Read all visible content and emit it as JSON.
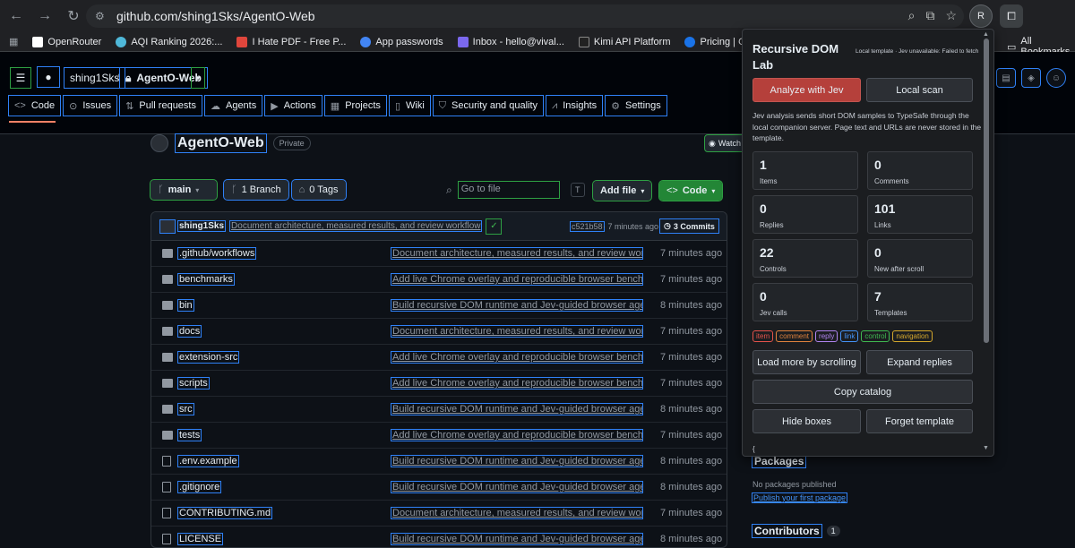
{
  "browser": {
    "url": "github.com/shing1Sks/AgentO-Web",
    "profile_initial": "R",
    "bookmarks": [
      {
        "label": "OpenRouter",
        "color": "#ffffff"
      },
      {
        "label": "AQI Ranking 2026:...",
        "color": "#4fb8d9"
      },
      {
        "label": "I Hate PDF - Free P...",
        "color": "#e0463c"
      },
      {
        "label": "App passwords",
        "color": "#4285f4"
      },
      {
        "label": "Inbox - hello@vival...",
        "color": "#7b68ee"
      },
      {
        "label": "Kimi API Platform",
        "color": "#222222"
      },
      {
        "label": "Pricing | OpenAI API",
        "color": "#1a73e8"
      }
    ],
    "all_bookmarks": "All Bookmarks"
  },
  "repo": {
    "owner": "shing1Sks",
    "name": "AgentO-Web",
    "visibility": "Private",
    "tabs": [
      "Code",
      "Issues",
      "Pull requests",
      "Agents",
      "Actions",
      "Projects",
      "Wiki",
      "Security and quality",
      "Insights",
      "Settings"
    ],
    "watch_label": "Watch",
    "branch": "main",
    "branch_count": "1 Branch",
    "tag_count": "0 Tags",
    "search_placeholder": "Go to file",
    "search_key": "T",
    "add_file": "Add file",
    "code_btn": "Code"
  },
  "latest_commit": {
    "author": "shing1Sks",
    "message": "Document architecture, measured results, and review workflow",
    "sha": "c521b58",
    "time": "· 7 minutes ago",
    "commits": "3 Commits"
  },
  "files": [
    {
      "name": ".github/workflows",
      "type": "dir",
      "msg": "Document architecture, measured results, and review workflow",
      "time": "7 minutes ago"
    },
    {
      "name": "benchmarks",
      "type": "dir",
      "msg": "Add live Chrome overlay and reproducible browser benchma...",
      "time": "7 minutes ago"
    },
    {
      "name": "bin",
      "type": "dir",
      "msg": "Build recursive DOM runtime and Jev-guided browser agent",
      "time": "8 minutes ago"
    },
    {
      "name": "docs",
      "type": "dir",
      "msg": "Document architecture, measured results, and review workflow",
      "time": "7 minutes ago"
    },
    {
      "name": "extension-src",
      "type": "dir",
      "msg": "Add live Chrome overlay and reproducible browser benchma...",
      "time": "7 minutes ago"
    },
    {
      "name": "scripts",
      "type": "dir",
      "msg": "Add live Chrome overlay and reproducible browser benchma...",
      "time": "7 minutes ago"
    },
    {
      "name": "src",
      "type": "dir",
      "msg": "Build recursive DOM runtime and Jev-guided browser agent",
      "time": "8 minutes ago"
    },
    {
      "name": "tests",
      "type": "dir",
      "msg": "Add live Chrome overlay and reproducible browser benchma...",
      "time": "7 minutes ago"
    },
    {
      "name": ".env.example",
      "type": "file",
      "msg": "Build recursive DOM runtime and Jev-guided browser agent",
      "time": "8 minutes ago"
    },
    {
      "name": ".gitignore",
      "type": "file",
      "msg": "Build recursive DOM runtime and Jev-guided browser agent",
      "time": "8 minutes ago"
    },
    {
      "name": "CONTRIBUTING.md",
      "type": "file",
      "msg": "Document architecture, measured results, and review workflow",
      "time": "7 minutes ago"
    },
    {
      "name": "LICENSE",
      "type": "file",
      "msg": "Build recursive DOM runtime and Jev-guided browser agent",
      "time": "8 minutes ago"
    }
  ],
  "sidebar": {
    "packages_title": "Packages",
    "packages_text": "No packages published",
    "packages_link": "Publish your first package",
    "contributors_title": "Contributors",
    "contributors_count": "1"
  },
  "panel": {
    "title": "Recursive DOM Lab",
    "status": "Local template · Jev unavailable: Failed to fetch",
    "analyze_btn": "Analyze with Jev",
    "scan_btn": "Local scan",
    "description": "Jev analysis sends short DOM samples to TypeSafe through the local companion server. Page text and URLs are never stored in the template.",
    "stats": [
      {
        "value": "1",
        "label": "Items"
      },
      {
        "value": "0",
        "label": "Comments"
      },
      {
        "value": "0",
        "label": "Replies"
      },
      {
        "value": "101",
        "label": "Links"
      },
      {
        "value": "22",
        "label": "Controls"
      },
      {
        "value": "0",
        "label": "New after scroll"
      },
      {
        "value": "0",
        "label": "Jev calls"
      },
      {
        "value": "7",
        "label": "Templates"
      }
    ],
    "legend": [
      {
        "label": "item",
        "color": "#e5534b"
      },
      {
        "label": "comment",
        "color": "#e0823d"
      },
      {
        "label": "reply",
        "color": "#b083f0"
      },
      {
        "label": "link",
        "color": "#4493f8"
      },
      {
        "label": "control",
        "color": "#3fb950"
      },
      {
        "label": "navigation",
        "color": "#d4a72c"
      }
    ],
    "load_more_btn": "Load more by scrolling",
    "expand_btn": "Expand replies",
    "copy_btn": "Copy catalog",
    "hide_btn": "Hide boxes",
    "forget_btn": "Forget template",
    "trailing": "{"
  }
}
